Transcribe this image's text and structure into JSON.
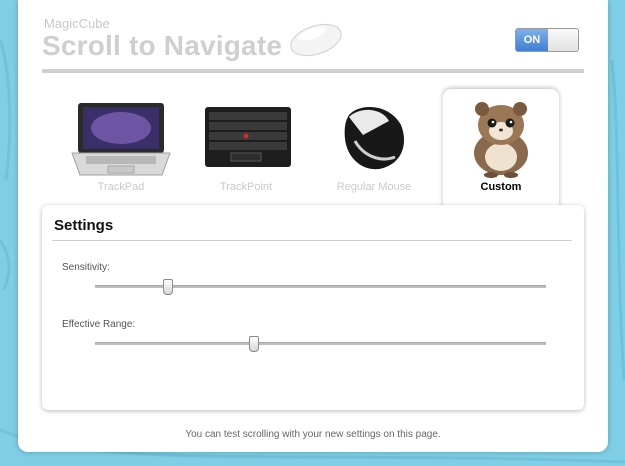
{
  "header": {
    "app_name": "MagicCube",
    "title": "Scroll to Navigate",
    "toggle_label": "ON"
  },
  "devices": [
    {
      "label": "TrackPad",
      "icon": "laptop-icon",
      "active": false
    },
    {
      "label": "TrackPoint",
      "icon": "keyboard-icon",
      "active": false
    },
    {
      "label": "Regular Mouse",
      "icon": "mouse-icon",
      "active": false
    },
    {
      "label": "Custom",
      "icon": "hamster-icon",
      "active": true
    }
  ],
  "settings": {
    "title": "Settings",
    "sensitivity": {
      "label": "Sensitivity:",
      "value": 0.16
    },
    "effective_range": {
      "label": "Effective Range:",
      "value": 0.35
    }
  },
  "footer": {
    "note": "You can test scrolling with your new settings on this page."
  },
  "colors": {
    "background": "#7ecfe6",
    "toggle_on": "#3f7ed3"
  }
}
